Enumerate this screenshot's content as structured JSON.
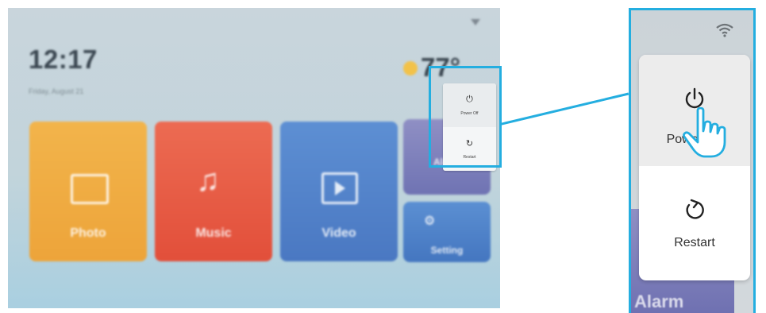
{
  "device_screen": {
    "time": "12:17",
    "date": "Friday, August 21",
    "temperature": "77°",
    "tiles": [
      {
        "label": "Photo",
        "color": "#f2b44b"
      },
      {
        "label": "Music",
        "color": "#ec6b52"
      },
      {
        "label": "Video",
        "color": "#5d8fd3"
      },
      {
        "label": "Alarm",
        "color": "#8f8fc4"
      },
      {
        "label": "Setting",
        "color": "#5b8fd2"
      }
    ],
    "power_menu": {
      "power_off_label": "Power Off",
      "restart_label": "Restart"
    }
  },
  "zoom_view": {
    "power_off_label": "Power Off",
    "restart_label": "Restart",
    "background_tile_label": "Alarm"
  },
  "colors": {
    "highlight": "#24aee0",
    "menu_bg": "#ffffff",
    "menu_pressed": "#ececec"
  },
  "icons": [
    "wifi-icon",
    "sun-icon",
    "photo-icon",
    "music-icon",
    "video-icon",
    "gear-icon",
    "power-icon",
    "restart-icon",
    "pointing-hand-icon"
  ]
}
